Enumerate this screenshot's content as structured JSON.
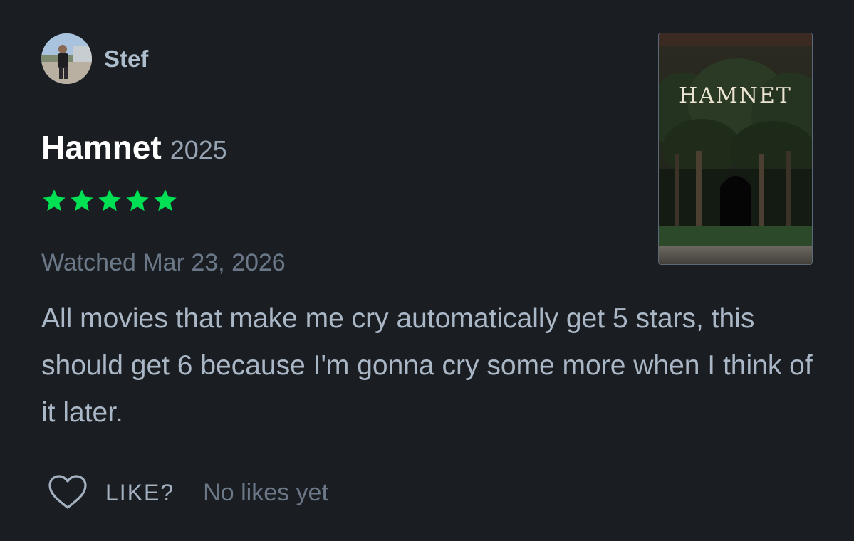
{
  "author": {
    "name": "Stef"
  },
  "film": {
    "title": "Hamnet",
    "year": "2025",
    "poster_title": "HAMNET"
  },
  "rating": {
    "stars": 5,
    "max": 5,
    "color": "#00e054"
  },
  "watched_text": "Watched Mar 23, 2026",
  "review_text": "All movies that make me cry automatically get 5 stars, this should get 6 because I'm gonna cry some more when I think of it later.",
  "like": {
    "label": "LIKE?",
    "count_text": "No likes yet",
    "icon": "heart-outline-icon"
  },
  "colors": {
    "background": "#1a1d21",
    "accent_green": "#00e054"
  }
}
